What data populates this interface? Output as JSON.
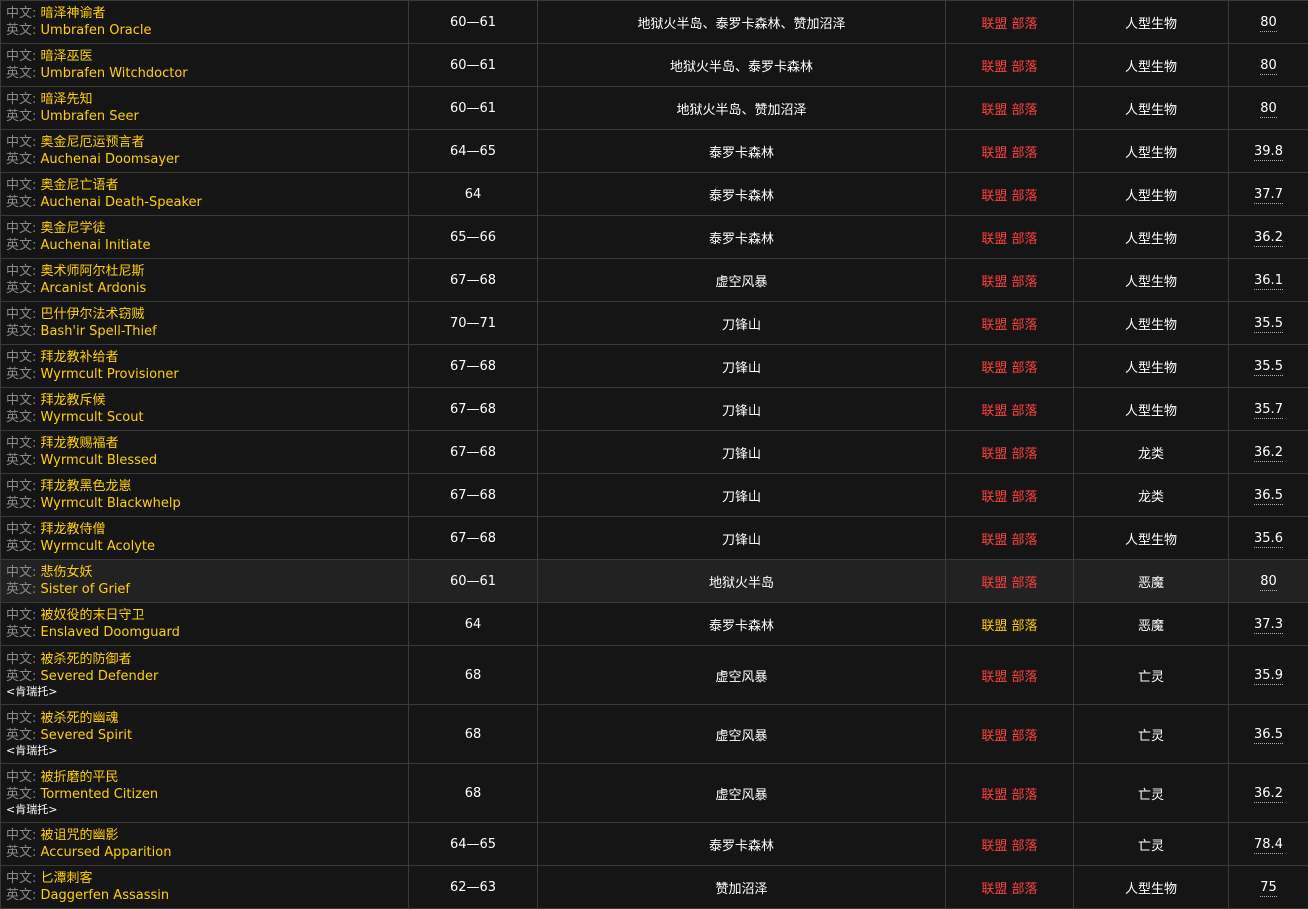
{
  "labels": {
    "zh_prefix": "中文:",
    "en_prefix": "英文:"
  },
  "rows": [
    {
      "zh": "暗泽神谕者",
      "en": "Umbrafen Oracle",
      "title": "",
      "level": "60—61",
      "zone": "地狱火半岛、泰罗卡森林、赞加沼泽",
      "reaction": "联盟 部落",
      "type": "人型生物",
      "value": "80"
    },
    {
      "zh": "暗泽巫医",
      "en": "Umbrafen Witchdoctor",
      "title": "",
      "level": "60—61",
      "zone": "地狱火半岛、泰罗卡森林",
      "reaction": "联盟 部落",
      "type": "人型生物",
      "value": "80"
    },
    {
      "zh": "暗泽先知",
      "en": "Umbrafen Seer",
      "title": "",
      "level": "60—61",
      "zone": "地狱火半岛、赞加沼泽",
      "reaction": "联盟 部落",
      "type": "人型生物",
      "value": "80"
    },
    {
      "zh": "奥金尼厄运预言者",
      "en": "Auchenai Doomsayer",
      "title": "",
      "level": "64—65",
      "zone": "泰罗卡森林",
      "reaction": "联盟 部落",
      "type": "人型生物",
      "value": "39.8"
    },
    {
      "zh": "奥金尼亡语者",
      "en": "Auchenai Death-Speaker",
      "title": "",
      "level": "64",
      "zone": "泰罗卡森林",
      "reaction": "联盟 部落",
      "type": "人型生物",
      "value": "37.7"
    },
    {
      "zh": "奥金尼学徒",
      "en": "Auchenai Initiate",
      "title": "",
      "level": "65—66",
      "zone": "泰罗卡森林",
      "reaction": "联盟 部落",
      "type": "人型生物",
      "value": "36.2"
    },
    {
      "zh": "奥术师阿尔杜尼斯",
      "en": "Arcanist Ardonis",
      "title": "",
      "level": "67—68",
      "zone": "虚空风暴",
      "reaction": "联盟 部落",
      "type": "人型生物",
      "value": "36.1"
    },
    {
      "zh": "巴什伊尔法术窃贼",
      "en": "Bash'ir Spell-Thief",
      "title": "",
      "level": "70—71",
      "zone": "刀锋山",
      "reaction": "联盟 部落",
      "type": "人型生物",
      "value": "35.5"
    },
    {
      "zh": "拜龙教补给者",
      "en": "Wyrmcult Provisioner",
      "title": "",
      "level": "67—68",
      "zone": "刀锋山",
      "reaction": "联盟 部落",
      "type": "人型生物",
      "value": "35.5"
    },
    {
      "zh": "拜龙教斥候",
      "en": "Wyrmcult Scout",
      "title": "",
      "level": "67—68",
      "zone": "刀锋山",
      "reaction": "联盟 部落",
      "type": "人型生物",
      "value": "35.7"
    },
    {
      "zh": "拜龙教赐福者",
      "en": "Wyrmcult Blessed",
      "title": "",
      "level": "67—68",
      "zone": "刀锋山",
      "reaction": "联盟 部落",
      "type": "龙类",
      "value": "36.2"
    },
    {
      "zh": "拜龙教黑色龙崽",
      "en": "Wyrmcult Blackwhelp",
      "title": "",
      "level": "67—68",
      "zone": "刀锋山",
      "reaction": "联盟 部落",
      "type": "龙类",
      "value": "36.5"
    },
    {
      "zh": "拜龙教侍僧",
      "en": "Wyrmcult Acolyte",
      "title": "",
      "level": "67—68",
      "zone": "刀锋山",
      "reaction": "联盟 部落",
      "type": "人型生物",
      "value": "35.6"
    },
    {
      "zh": "悲伤女妖",
      "en": "Sister of Grief",
      "title": "",
      "level": "60—61",
      "zone": "地狱火半岛",
      "reaction": "联盟 部落",
      "type": "恶魔",
      "value": "80"
    },
    {
      "zh": "被奴役的末日守卫",
      "en": "Enslaved Doomguard",
      "title": "",
      "level": "64",
      "zone": "泰罗卡森林",
      "reaction": "联盟 部落",
      "type": "恶魔",
      "value": "37.3"
    },
    {
      "zh": "被杀死的防御者",
      "en": "Severed Defender",
      "title": "<肯瑞托>",
      "level": "68",
      "zone": "虚空风暴",
      "reaction": "联盟 部落",
      "type": "亡灵",
      "value": "35.9"
    },
    {
      "zh": "被杀死的幽魂",
      "en": "Severed Spirit",
      "title": "<肯瑞托>",
      "level": "68",
      "zone": "虚空风暴",
      "reaction": "联盟 部落",
      "type": "亡灵",
      "value": "36.5"
    },
    {
      "zh": "被折磨的平民",
      "en": "Tormented Citizen",
      "title": "<肯瑞托>",
      "level": "68",
      "zone": "虚空风暴",
      "reaction": "联盟 部落",
      "type": "亡灵",
      "value": "36.2"
    },
    {
      "zh": "被诅咒的幽影",
      "en": "Accursed Apparition",
      "title": "",
      "level": "64—65",
      "zone": "泰罗卡森林",
      "reaction": "联盟 部落",
      "type": "亡灵",
      "value": "78.4"
    },
    {
      "zh": "匕潭刺客",
      "en": "Daggerfen Assassin",
      "title": "",
      "level": "62—63",
      "zone": "赞加沼泽",
      "reaction": "联盟 部落",
      "type": "人型生物",
      "value": "75"
    }
  ],
  "colors": {
    "background": "#151515",
    "highlight_row": "#222222",
    "name_yellow": "#ffd100",
    "label_gray": "#8a8a8a",
    "hostile_red": "#ff4040",
    "neutral_yellow": "#ffd100",
    "border": "#3a3a3a"
  },
  "row_states": {
    "highlighted_index": 13,
    "neutral_reaction_index": 14
  }
}
